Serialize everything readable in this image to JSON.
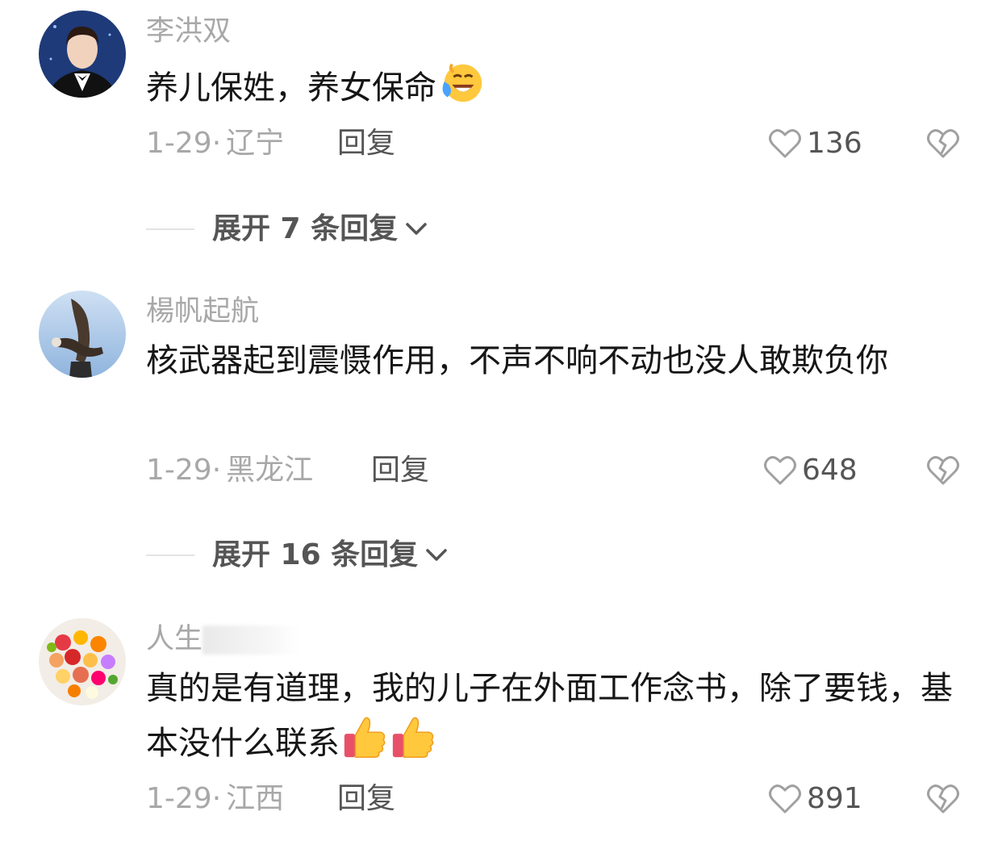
{
  "comments": [
    {
      "username": "李洪双",
      "text": "养儿保姓，养女保命",
      "emoji": "laughing-tears-emoji",
      "date": "1-29",
      "location": "辽宁",
      "reply_label": "回复",
      "likes": "136",
      "expand_label": "展开 7 条回复"
    },
    {
      "username": "楊帆起航",
      "text": "核武器起到震慑作用，不声不响不动也没人敢欺负你",
      "date": "1-29",
      "location": "黑龙江",
      "reply_label": "回复",
      "likes": "648",
      "expand_label": "展开 16 条回复"
    },
    {
      "username": "人生",
      "text": "真的是有道理，我的儿子在外面工作念书，除了要钱，基本没什么联系",
      "emoji": "thumbs-up-emoji",
      "date": "1-29",
      "location": "江西",
      "reply_label": "回复",
      "likes": "891"
    }
  ],
  "meta_separator": "·"
}
